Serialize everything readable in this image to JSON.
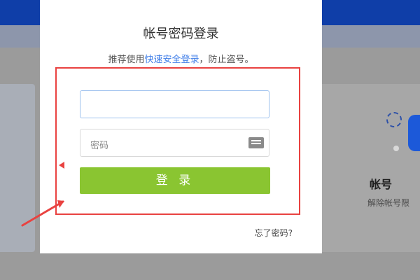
{
  "modal": {
    "title": "帐号密码登录",
    "subtitle_prefix": "推荐使用",
    "subtitle_link": "快速安全登录",
    "subtitle_suffix": "，防止盗号。",
    "password_placeholder": "密码",
    "login_button": "登 录",
    "forgot_link": "忘了密码?"
  },
  "background": {
    "right_title": "帐号",
    "right_subtitle": "解除帐号限"
  },
  "colors": {
    "header_blue": "#0f3ea8",
    "accent_link": "#3f7ee8",
    "button_green": "#8ac531",
    "highlight_red": "#e94240"
  }
}
